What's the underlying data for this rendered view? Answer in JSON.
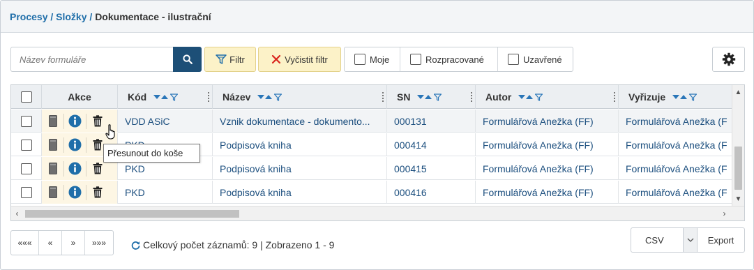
{
  "breadcrumb": {
    "part1": "Procesy",
    "sep1": " / ",
    "part2": "Složky",
    "sep2": " / ",
    "current": "Dokumentace - ilustrační"
  },
  "search": {
    "placeholder": "Název formuláře"
  },
  "toolbar": {
    "filter_label": "Filtr",
    "clear_label": "Vyčistit filtr"
  },
  "toggles": [
    {
      "label": "Moje"
    },
    {
      "label": "Rozpracované"
    },
    {
      "label": "Uzavřené"
    }
  ],
  "grid": {
    "columns": {
      "actions": "Akce",
      "code": "Kód",
      "name": "Název",
      "sn": "SN",
      "author": "Autor",
      "handler": "Vyřizuje"
    },
    "rows": [
      {
        "code": "VDD ASiC",
        "name": "Vznik dokumentace - dokumento...",
        "sn": "000131",
        "author": "Formulářová Anežka (FF)",
        "handler": "Formulářová Anežka (F"
      },
      {
        "code": "PKD",
        "name": "Podpisová kniha",
        "sn": "000414",
        "author": "Formulářová Anežka (FF)",
        "handler": "Formulářová Anežka (F"
      },
      {
        "code": "PKD",
        "name": "Podpisová kniha",
        "sn": "000415",
        "author": "Formulářová Anežka (FF)",
        "handler": "Formulářová Anežka (F"
      },
      {
        "code": "PKD",
        "name": "Podpisová kniha",
        "sn": "000416",
        "author": "Formulářová Anežka (FF)",
        "handler": "Formulářová Anežka (F"
      }
    ]
  },
  "tooltip": {
    "text": "Přesunout do koše"
  },
  "pager": {
    "first": "«««",
    "prev": "«",
    "next": "»",
    "last": "»»»"
  },
  "footer": {
    "total_text": "Celkový počet záznamů: 9 | Zobrazeno 1 - 9"
  },
  "export": {
    "format": "CSV",
    "button_label": "Export"
  },
  "colors": {
    "link": "#1f6ea9",
    "search_button": "#1d4f77",
    "filter_bg": "#fcf2c8",
    "sort_arrow": "#2a76b8",
    "action_bg": "#fdf6e4"
  }
}
